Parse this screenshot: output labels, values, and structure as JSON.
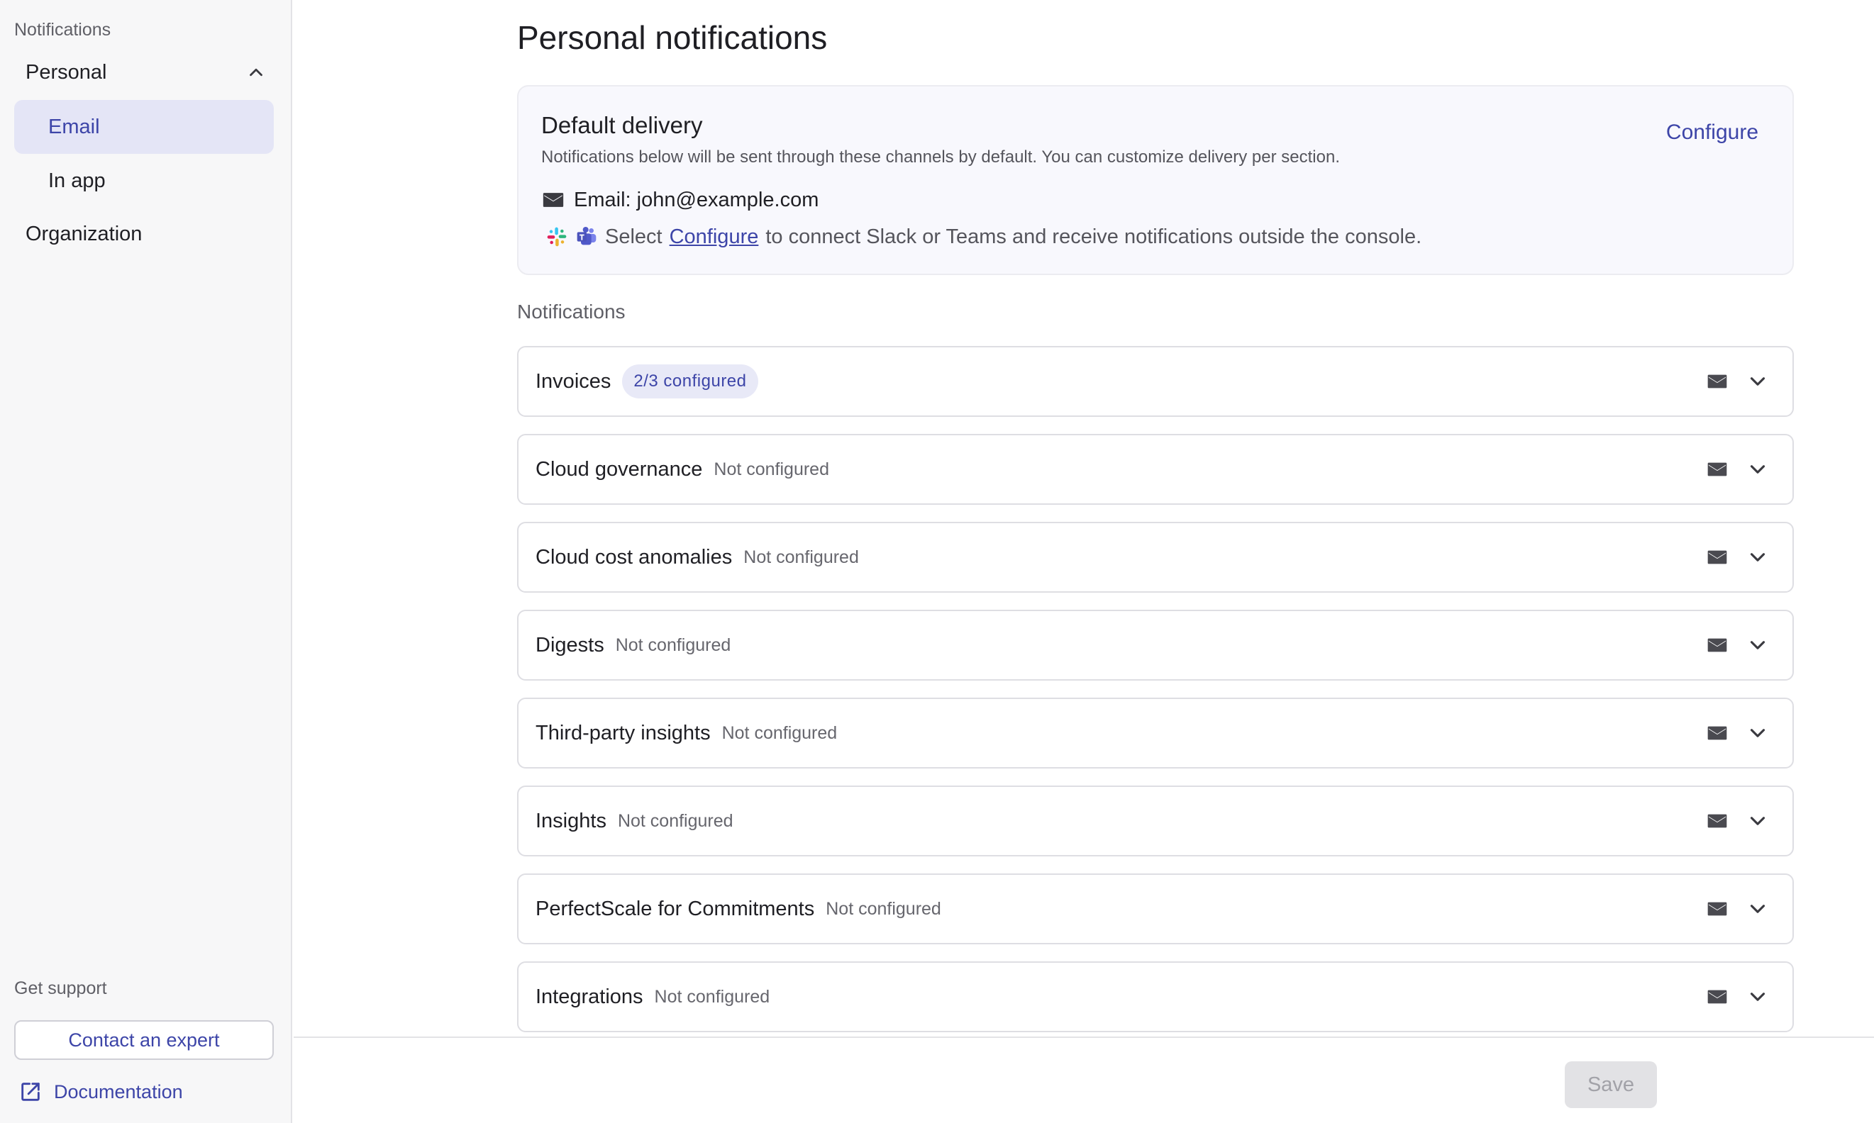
{
  "sidebar": {
    "heading": "Notifications",
    "group": {
      "label": "Personal",
      "expanded": true
    },
    "items": [
      {
        "label": "Email",
        "active": true
      },
      {
        "label": "In app",
        "active": false
      }
    ],
    "organization_label": "Organization",
    "support_heading": "Get support",
    "contact_label": "Contact an expert",
    "documentation_label": "Documentation"
  },
  "main": {
    "title": "Personal notifications",
    "default_delivery": {
      "title": "Default delivery",
      "configure_label": "Configure",
      "description": "Notifications below will be sent through these channels by default. You can customize delivery per section.",
      "email_text": "Email: john@example.com",
      "connect_prefix": "Select",
      "connect_link": "Configure",
      "connect_suffix": "to connect Slack or Teams and receive notifications outside the console."
    },
    "section_label": "Notifications",
    "rows": [
      {
        "title": "Invoices",
        "status": "2/3 configured",
        "badge": true
      },
      {
        "title": "Cloud governance",
        "status": "Not configured",
        "badge": false
      },
      {
        "title": "Cloud cost anomalies",
        "status": "Not configured",
        "badge": false
      },
      {
        "title": "Digests",
        "status": "Not configured",
        "badge": false
      },
      {
        "title": "Third-party insights",
        "status": "Not configured",
        "badge": false
      },
      {
        "title": "Insights",
        "status": "Not configured",
        "badge": false
      },
      {
        "title": "PerfectScale for Commitments",
        "status": "Not configured",
        "badge": false
      },
      {
        "title": "Integrations",
        "status": "Not configured",
        "badge": false
      }
    ]
  },
  "footer": {
    "save_label": "Save",
    "save_enabled": false
  },
  "colors": {
    "accent": "#3d45a8",
    "active_bg": "#e4e5f6",
    "badge_bg": "#e8e9f7"
  },
  "icons": [
    "chevron-up-icon",
    "external-link-icon",
    "mail-icon",
    "slack-icon",
    "teams-icon",
    "chevron-down-icon"
  ]
}
